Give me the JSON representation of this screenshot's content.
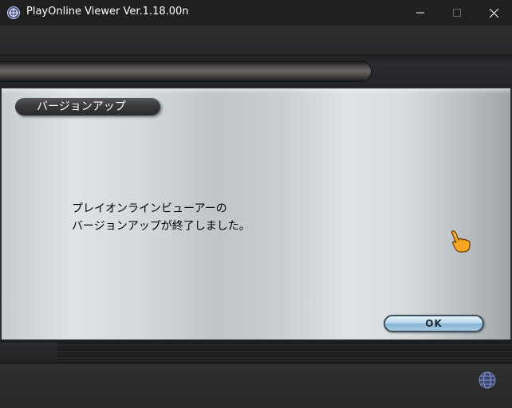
{
  "window": {
    "title": "PlayOnline Viewer Ver.1.18.00n",
    "controls": {
      "minimize": "minimize-icon",
      "maximize": "maximize-icon",
      "close": "close-icon"
    }
  },
  "dialog": {
    "heading": "バージョンアップ",
    "message_line1": "プレイオンラインビューアーの",
    "message_line2": "バージョンアップが終了しました。",
    "ok_label": "OK"
  },
  "colors": {
    "accent_button": "#a8cce4",
    "title_pill": "#3a3a3c",
    "cursor": "#f5a623"
  },
  "icons": {
    "app": "playonline-icon",
    "cursor": "pointing-hand-cursor-icon",
    "footer": "globe-icon"
  }
}
